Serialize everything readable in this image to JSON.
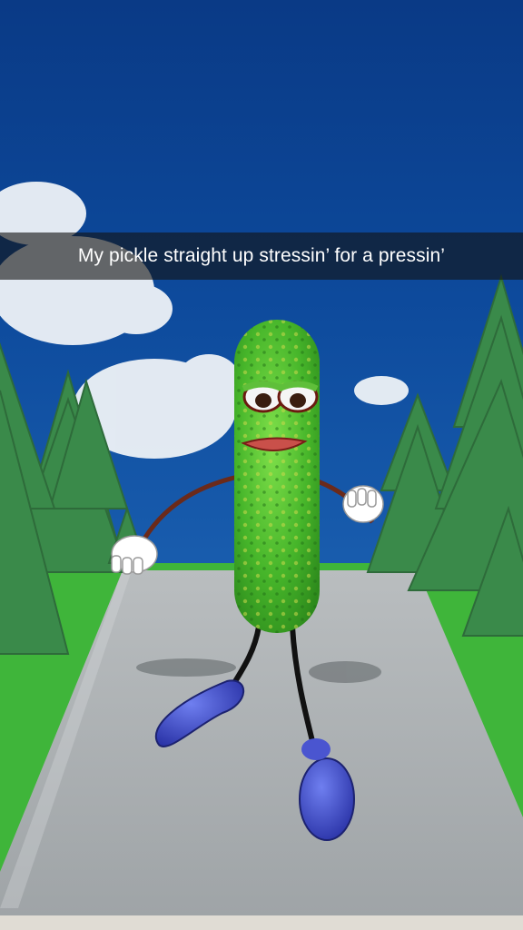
{
  "snap": {
    "caption": "My pickle straight up stressin’ for a pressin’"
  },
  "colors": {
    "sky": "#0d4a96",
    "grass": "#3fb53a",
    "road": "#a9aeb0",
    "pickle": "#4fbf2a",
    "shoes": "#3b48c4"
  }
}
